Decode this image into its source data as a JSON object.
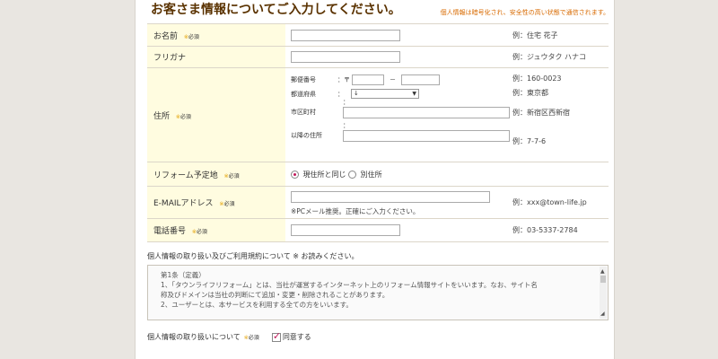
{
  "header": {
    "title": "お客さま情報についてご入力してください。",
    "note": "個人情報は暗号化され、安全性の高い状態で通信されます。"
  },
  "required_label": "必須",
  "required_mark": "※",
  "fields": {
    "name": {
      "label": "お名前",
      "example": "例：住宅 花子"
    },
    "kana": {
      "label": "フリガナ",
      "example": "例：ジュウタク ハナコ"
    },
    "address": {
      "label": "住所",
      "postal_label": "郵便番号",
      "postal_prefix": "：〒",
      "postal_dash": "－",
      "postal_example": "例：160-0023",
      "pref_label": "都道府県",
      "pref_colon": "：",
      "pref_value": "↓",
      "pref_example": "例：東京都",
      "city_label": "市区町村",
      "city_colon": "：",
      "city_example": "例：新宿区西新宿",
      "rest_label": "以降の住所",
      "rest_colon": "：",
      "rest_example": "例：7-7-6"
    },
    "reform_place": {
      "label": "リフォーム予定地",
      "option_same": "現住所と同じ",
      "option_other": "別住所",
      "selected": "option_same"
    },
    "email": {
      "label": "E-MAILアドレス",
      "note": "※PCメール推奨。正確にご入力ください。",
      "example": "例：xxx@town-life.jp"
    },
    "phone": {
      "label": "電話番号",
      "example": "例：03-5337-2784"
    }
  },
  "consent": {
    "title": "個人情報の取り扱い及びご利用規約について ※ お読みください。",
    "policy_lines": [
      "第1条（定義）",
      "1、「タウンライフリフォーム」とは、当社が運営するインターネット上のリフォーム情報サイトをいいます。なお、サイト名",
      "称及びドメインは当社の判断にて追加・変更・削除されることがあります。",
      "2、ユーザーとは、本サービスを利用する全ての方をいいます。"
    ],
    "agree_label": "個人情報の取り扱いについて",
    "agree_checkbox": "同意する",
    "agreed": true
  },
  "colors": {
    "required": "#e2a000",
    "accent": "#c2185b",
    "label_bg": "#fffce0",
    "title": "#5a3200"
  }
}
